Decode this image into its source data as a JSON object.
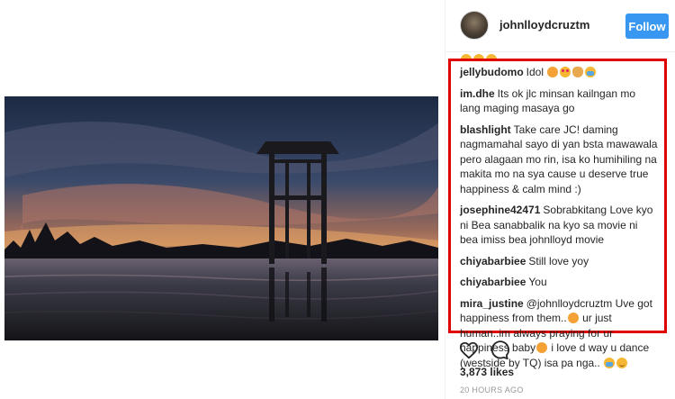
{
  "post": {
    "username": "johnlloydcruztm",
    "follow_label": "Follow",
    "likes": "3,873 likes",
    "timestamp": "20 HOURS AGO"
  },
  "comments": [
    {
      "user": "jellybudomo",
      "text": "Idol",
      "emojis": [
        "kiss-emoji",
        "heart-eyes-emoji",
        "ok-hand-emoji",
        "crying-emoji"
      ]
    },
    {
      "user": "im.dhe",
      "text": "Its ok jlc minsan kailngan mo lang maging masaya go",
      "emojis": []
    },
    {
      "user": "blashlight",
      "text": "Take care JC! daming nagmamahal sayo di yan bsta mawawala pero alagaan mo rin, isa ko humihiling na makita mo na sya cause u deserve true happiness & calm mind :)",
      "emojis": []
    },
    {
      "user": "josephine42471",
      "text": "Sobrabkitang Love kyo ni Bea sanabbalik na kyo sa movie ni bea imiss bea johnlloyd movie",
      "emojis": []
    },
    {
      "user": "chiyabarbiee",
      "text": "Still love yoy",
      "emojis": []
    },
    {
      "user": "chiyabarbiee",
      "text": "You",
      "emojis": []
    }
  ],
  "last_comment": {
    "user": "mira_justine",
    "part1": "@johnlloydcruztm Uve got happiness from them..",
    "part2": " ur just human..im always praying for ur happiness baby",
    "part3": " i love d way u dance (westside by TQ) isa pa nga..",
    "emojis": [
      "kiss-emoji",
      "blush-emoji",
      "crying-emoji",
      "smile-emoji"
    ]
  },
  "colors": {
    "follow_button": "#3897f0",
    "highlight_border": "#e00000"
  },
  "icons": [
    "heart-icon",
    "comment-icon"
  ]
}
